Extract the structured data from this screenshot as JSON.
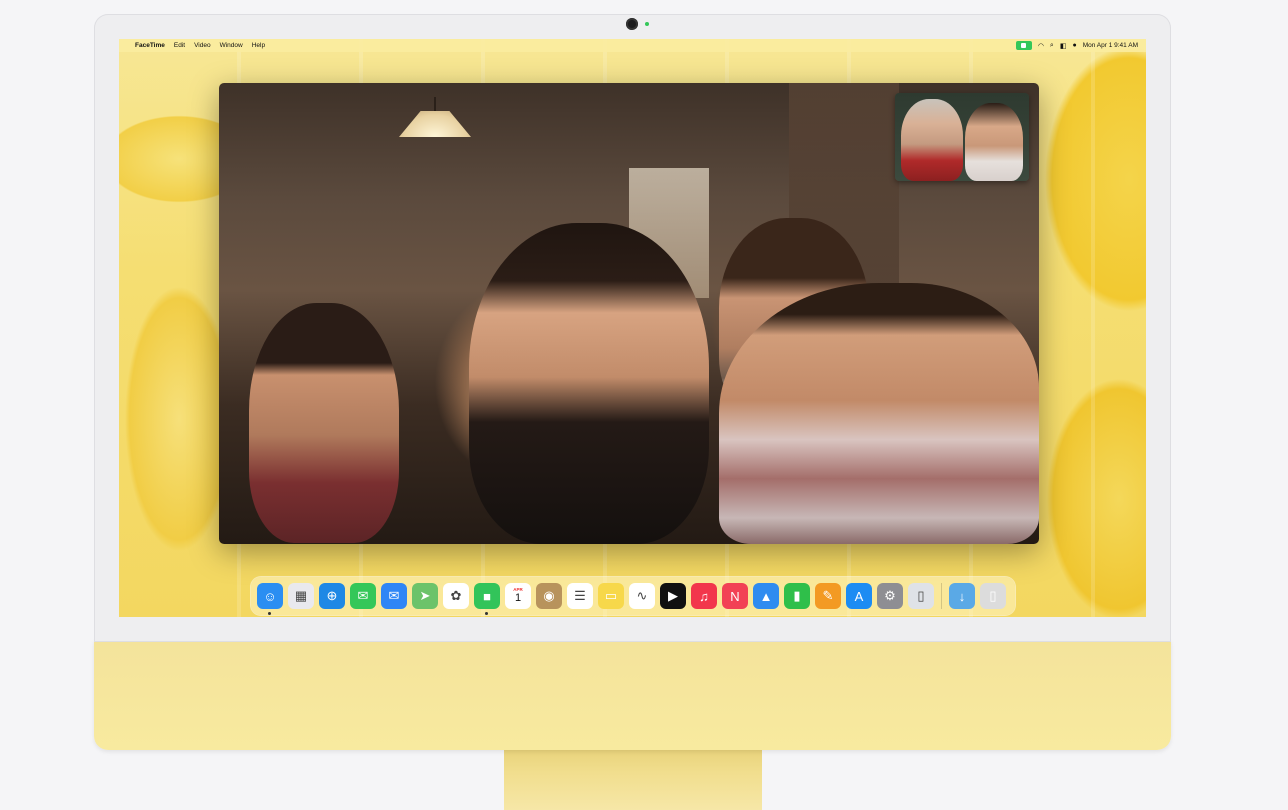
{
  "menubar": {
    "apple_glyph": "",
    "app_name": "FaceTime",
    "menus": [
      "Edit",
      "Video",
      "Window",
      "Help"
    ],
    "datetime": "Mon Apr 1  9:41 AM"
  },
  "dock": {
    "calendar_month": "APR",
    "calendar_day": "1",
    "apps": [
      {
        "name": "finder-icon",
        "glyph": "☺",
        "bg": "#2b8ef2",
        "running": true
      },
      {
        "name": "launchpad-icon",
        "glyph": "▦",
        "bg": "#e9e9ee",
        "running": false
      },
      {
        "name": "safari-icon",
        "glyph": "⊕",
        "bg": "#1e88e5",
        "running": false
      },
      {
        "name": "messages-icon",
        "glyph": "✉",
        "bg": "#34c759",
        "running": false
      },
      {
        "name": "mail-icon",
        "glyph": "✉",
        "bg": "#2f86f6",
        "running": false
      },
      {
        "name": "maps-icon",
        "glyph": "➤",
        "bg": "#6cc36a",
        "running": false
      },
      {
        "name": "photos-icon",
        "glyph": "✿",
        "bg": "#ffffff",
        "running": false
      },
      {
        "name": "facetime-icon",
        "glyph": "■",
        "bg": "#32c45a",
        "running": true
      },
      {
        "name": "calendar-icon",
        "glyph": "",
        "bg": "#ffffff",
        "running": false
      },
      {
        "name": "contacts-icon",
        "glyph": "◉",
        "bg": "#b8935c",
        "running": false
      },
      {
        "name": "reminders-icon",
        "glyph": "☰",
        "bg": "#ffffff",
        "running": false
      },
      {
        "name": "notes-icon",
        "glyph": "▭",
        "bg": "#f7d84a",
        "running": false
      },
      {
        "name": "freeform-icon",
        "glyph": "∿",
        "bg": "#ffffff",
        "running": false
      },
      {
        "name": "tv-icon",
        "glyph": "▶",
        "bg": "#111111",
        "running": false
      },
      {
        "name": "music-icon",
        "glyph": "♫",
        "bg": "#f2364c",
        "running": false
      },
      {
        "name": "news-icon",
        "glyph": "N",
        "bg": "#f24155",
        "running": false
      },
      {
        "name": "keynote-icon",
        "glyph": "▲",
        "bg": "#2f8cf0",
        "running": false
      },
      {
        "name": "numbers-icon",
        "glyph": "▮",
        "bg": "#2fbf4a",
        "running": false
      },
      {
        "name": "pages-icon",
        "glyph": "✎",
        "bg": "#f39a23",
        "running": false
      },
      {
        "name": "app-store-icon",
        "glyph": "A",
        "bg": "#1c8cf3",
        "running": false
      },
      {
        "name": "system-settings-icon",
        "glyph": "⚙",
        "bg": "#8e8e93",
        "running": false
      },
      {
        "name": "iphone-mirroring-icon",
        "glyph": "▯",
        "bg": "#dfe2e7",
        "running": false
      }
    ],
    "trailing": [
      {
        "name": "downloads-folder-icon",
        "glyph": "↓",
        "bg": "#5aa9e6"
      },
      {
        "name": "trash-icon",
        "glyph": "▯",
        "bg": "#dcdcdc"
      }
    ]
  }
}
